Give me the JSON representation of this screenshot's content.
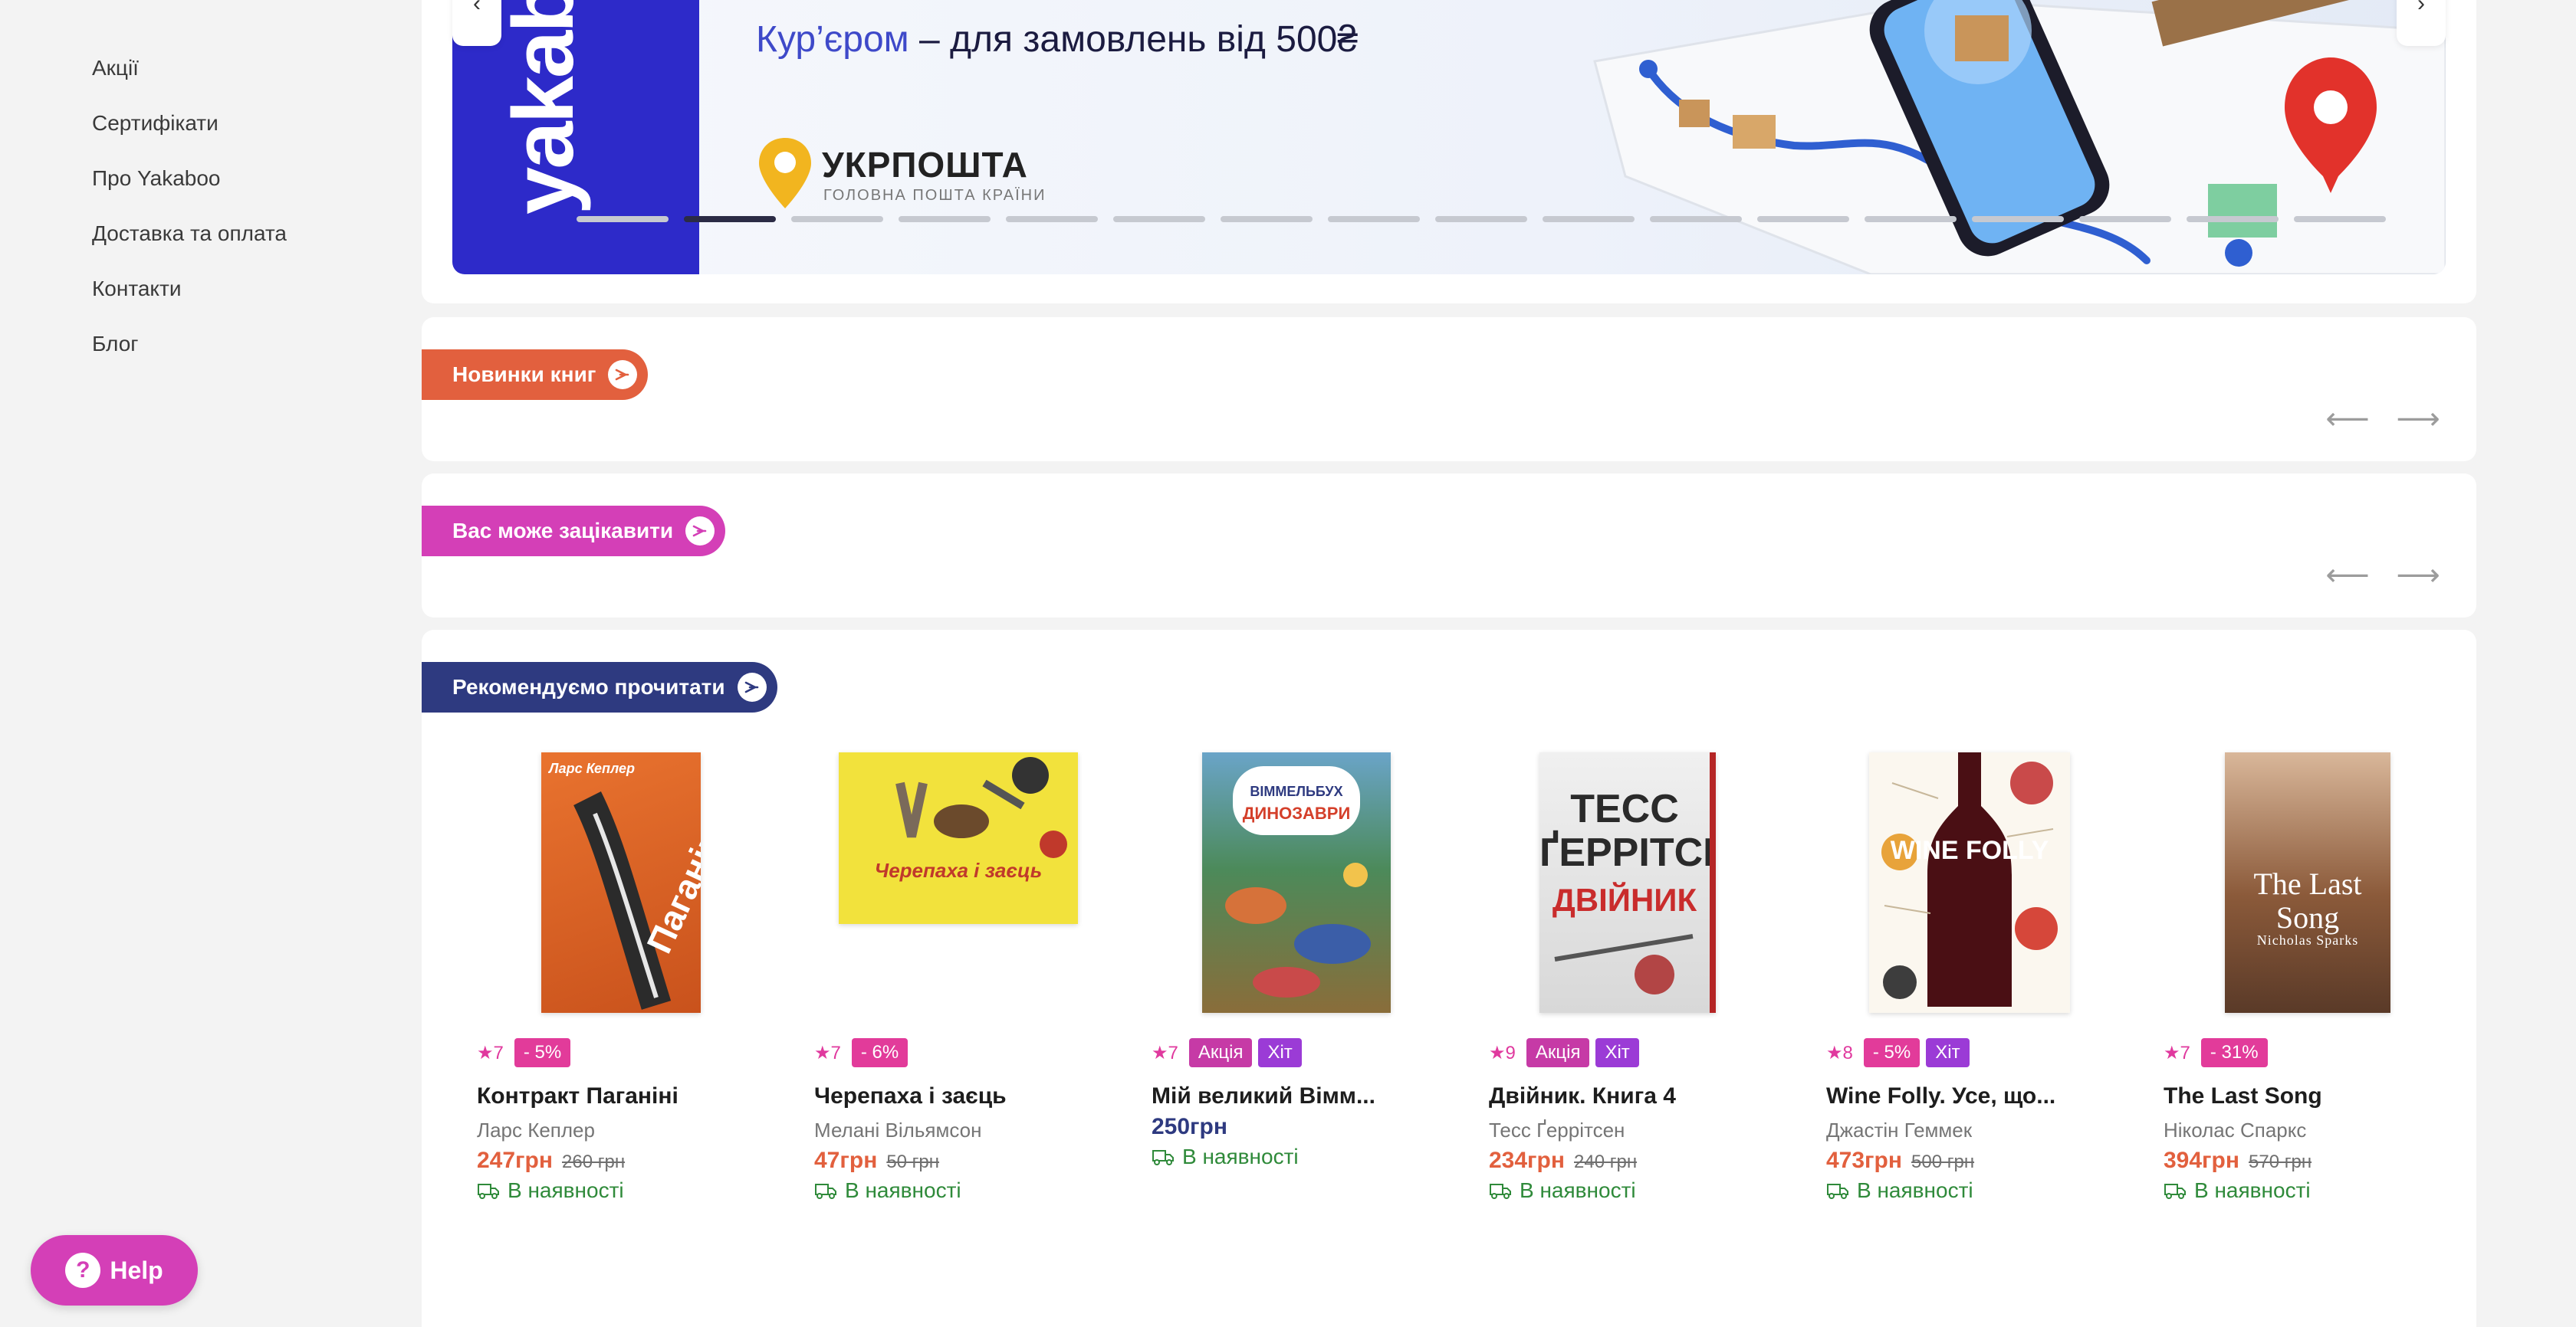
{
  "sidebar": {
    "items": [
      {
        "label": "Акції"
      },
      {
        "label": "Сертифікати"
      },
      {
        "label": "Про Yakaboo"
      },
      {
        "label": "Доставка та оплата"
      },
      {
        "label": "Контакти"
      },
      {
        "label": "Блог"
      }
    ]
  },
  "banner": {
    "brand": "yakaboo",
    "headline_accent": "Кур’єром",
    "headline_rest": " – для замовлень від 500₴",
    "carrier_name": "УКРПОШТА",
    "carrier_tagline": "ГОЛОВНА ПОШТА КРАЇНИ",
    "slide_count": 17,
    "active_slide": 2,
    "colors": {
      "brand_bg": "#2d2ac9",
      "accent": "#3e49c9",
      "carrier_yellow": "#f2b51f"
    }
  },
  "sections": {
    "news": {
      "title": "Новинки книг",
      "color": "#e2603e"
    },
    "interest": {
      "title": "Вас може зацікавити",
      "color": "#d43fb7"
    },
    "recommend": {
      "title": "Рекомендуємо прочитати",
      "color": "#2e3a80"
    }
  },
  "nav_arrows": {
    "prev": "⟵",
    "next": "⟶"
  },
  "products": [
    {
      "title": "Контракт Паганіні",
      "author": "Ларс Кеплер",
      "rating": "7",
      "badges": [
        {
          "type": "discount",
          "label": "- 5%"
        }
      ],
      "price": "247грн",
      "old_price": "260 грн",
      "stock": "В наявності",
      "cover": {
        "bg": "#e2672a",
        "text": "Паганіні",
        "top_text": "Ларс Кеплер"
      }
    },
    {
      "title": "Черепаха і заєць",
      "author": "Мелані Вільямсон",
      "rating": "7",
      "badges": [
        {
          "type": "discount",
          "label": "- 6%"
        }
      ],
      "price": "47грн",
      "old_price": "50 грн",
      "stock": "В наявності",
      "cover": {
        "bg": "#f2e23c",
        "text": "Черепаха і заєць",
        "top_text": ""
      }
    },
    {
      "title": "Мій великий Вімм...",
      "author": "",
      "rating": "7",
      "badges": [
        {
          "type": "sale",
          "label": "Акція"
        },
        {
          "type": "hit",
          "label": "Хіт"
        }
      ],
      "price": "250грн",
      "old_price": "",
      "stock": "В наявності",
      "cover": {
        "bg": "#4c8a5a",
        "text": "ДИНОЗАВРИ",
        "top_text": "ВІММЕЛЬБУХ"
      }
    },
    {
      "title": "Двійник. Книга 4",
      "author": "Тесс Ґеррітсен",
      "rating": "9",
      "badges": [
        {
          "type": "sale",
          "label": "Акція"
        },
        {
          "type": "hit",
          "label": "Хіт"
        }
      ],
      "price": "234грн",
      "old_price": "240 грн",
      "stock": "В наявності",
      "cover": {
        "bg": "#e4e4e4",
        "text": "ТЕСС ҐЕРРІТСЕН",
        "top_text": "ДВІЙНИК"
      }
    },
    {
      "title": "Wine Folly. Усе, що...",
      "author": "Джастін Геммек",
      "rating": "8",
      "badges": [
        {
          "type": "discount",
          "label": "- 5%"
        },
        {
          "type": "hit",
          "label": "Хіт"
        }
      ],
      "price": "473грн",
      "old_price": "500 грн",
      "stock": "В наявності",
      "cover": {
        "bg": "#fbf7ef",
        "text": "WINE FOLLY",
        "top_text": ""
      }
    },
    {
      "title": "The Last Song",
      "author": "Ніколас Спаркс",
      "rating": "7",
      "badges": [
        {
          "type": "discount",
          "label": "- 31%"
        }
      ],
      "price": "394грн",
      "old_price": "570 грн",
      "stock": "В наявності",
      "cover": {
        "bg": "#8b5a3a",
        "text": "The Last Song",
        "top_text": "Nicholas Sparks"
      }
    }
  ],
  "help": {
    "label": "Help",
    "icon_glyph": "?"
  }
}
